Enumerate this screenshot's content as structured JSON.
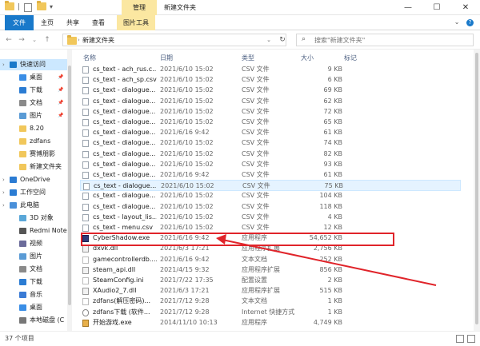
{
  "window": {
    "manage_tab": "管理",
    "title": "新建文件夹"
  },
  "ribbon": {
    "tabs": [
      "文件",
      "主页",
      "共享",
      "查看",
      "图片工具"
    ]
  },
  "address": {
    "path": "新建文件夹",
    "search_placeholder": "搜索\"新建文件夹\""
  },
  "sidebar": {
    "items": [
      {
        "label": "快速访问",
        "icon": "star-icon"
      },
      {
        "label": "桌面",
        "icon": "desktop-icon",
        "pinned": true
      },
      {
        "label": "下载",
        "icon": "download-icon",
        "pinned": true
      },
      {
        "label": "文档",
        "icon": "document-icon",
        "pinned": true
      },
      {
        "label": "图片",
        "icon": "picture-icon",
        "pinned": true
      },
      {
        "label": "8.20",
        "icon": "folder-icon"
      },
      {
        "label": "zdfans",
        "icon": "folder-icon"
      },
      {
        "label": "赛博朋影",
        "icon": "folder-icon"
      },
      {
        "label": "新建文件夹",
        "icon": "folder-icon"
      },
      {
        "label": "OneDrive",
        "icon": "cloud-icon"
      },
      {
        "label": "工作空间",
        "icon": "cloud-icon"
      },
      {
        "label": "此电脑",
        "icon": "computer-icon"
      },
      {
        "label": "3D 对象",
        "icon": "cube-icon"
      },
      {
        "label": "Redmi Note",
        "icon": "phone-icon"
      },
      {
        "label": "视频",
        "icon": "video-icon"
      },
      {
        "label": "图片",
        "icon": "picture-icon"
      },
      {
        "label": "文档",
        "icon": "document-icon"
      },
      {
        "label": "下载",
        "icon": "download-icon"
      },
      {
        "label": "音乐",
        "icon": "music-icon"
      },
      {
        "label": "桌面",
        "icon": "desktop-icon"
      },
      {
        "label": "本地磁盘 (C",
        "icon": "drive-icon"
      }
    ]
  },
  "columns": {
    "name": "名称",
    "date": "日期",
    "type": "类型",
    "size": "大小",
    "tags": "标记"
  },
  "files": [
    {
      "name": "cs_text - ach_rus.c...",
      "date": "2021/6/10 15:02",
      "type": "CSV 文件",
      "size": "9 KB",
      "icon": "csv-file-icon"
    },
    {
      "name": "cs_text - ach_sp.csv",
      "date": "2021/6/10 15:02",
      "type": "CSV 文件",
      "size": "6 KB",
      "icon": "csv-file-icon"
    },
    {
      "name": "cs_text - dialogue...",
      "date": "2021/6/10 15:02",
      "type": "CSV 文件",
      "size": "69 KB",
      "icon": "csv-file-icon"
    },
    {
      "name": "cs_text - dialogue...",
      "date": "2021/6/10 15:02",
      "type": "CSV 文件",
      "size": "62 KB",
      "icon": "csv-file-icon"
    },
    {
      "name": "cs_text - dialogue...",
      "date": "2021/6/10 15:02",
      "type": "CSV 文件",
      "size": "72 KB",
      "icon": "csv-file-icon"
    },
    {
      "name": "cs_text - dialogue...",
      "date": "2021/6/10 15:02",
      "type": "CSV 文件",
      "size": "65 KB",
      "icon": "csv-file-icon"
    },
    {
      "name": "cs_text - dialogue...",
      "date": "2021/6/16 9:42",
      "type": "CSV 文件",
      "size": "61 KB",
      "icon": "csv-file-icon"
    },
    {
      "name": "cs_text - dialogue...",
      "date": "2021/6/10 15:02",
      "type": "CSV 文件",
      "size": "74 KB",
      "icon": "csv-file-icon"
    },
    {
      "name": "cs_text - dialogue...",
      "date": "2021/6/10 15:02",
      "type": "CSV 文件",
      "size": "82 KB",
      "icon": "csv-file-icon"
    },
    {
      "name": "cs_text - dialogue...",
      "date": "2021/6/10 15:02",
      "type": "CSV 文件",
      "size": "93 KB",
      "icon": "csv-file-icon"
    },
    {
      "name": "cs_text - dialogue...",
      "date": "2021/6/16 9:42",
      "type": "CSV 文件",
      "size": "61 KB",
      "icon": "csv-file-icon"
    },
    {
      "name": "cs_text - dialogue...",
      "date": "2021/6/10 15:02",
      "type": "CSV 文件",
      "size": "75 KB",
      "icon": "csv-file-icon",
      "selected": true
    },
    {
      "name": "cs_text - dialogue...",
      "date": "2021/6/10 15:02",
      "type": "CSV 文件",
      "size": "104 KB",
      "icon": "csv-file-icon"
    },
    {
      "name": "cs_text - dialogue...",
      "date": "2021/6/10 15:02",
      "type": "CSV 文件",
      "size": "118 KB",
      "icon": "csv-file-icon"
    },
    {
      "name": "cs_text - layout_lis...",
      "date": "2021/6/10 15:02",
      "type": "CSV 文件",
      "size": "4 KB",
      "icon": "csv-file-icon"
    },
    {
      "name": "cs_text - menu.csv",
      "date": "2021/6/10 15:02",
      "type": "CSV 文件",
      "size": "12 KB",
      "icon": "csv-file-icon"
    },
    {
      "name": "CyberShadow.exe",
      "date": "2021/6/16 9:42",
      "type": "应用程序",
      "size": "54,652 KB",
      "icon": "game-exe-icon"
    },
    {
      "name": "dxvk.dll",
      "date": "2021/6/3 17:21",
      "type": "应用程序扩展",
      "size": "2,756 KB",
      "icon": "dll-file-icon"
    },
    {
      "name": "gamecontrollerdb....",
      "date": "2021/6/16 9:42",
      "type": "文本文档",
      "size": "252 KB",
      "icon": "text-file-icon"
    },
    {
      "name": "steam_api.dll",
      "date": "2021/4/15 9:32",
      "type": "应用程序扩展",
      "size": "856 KB",
      "icon": "dll-file-icon"
    },
    {
      "name": "SteamConfig.ini",
      "date": "2021/7/22 17:35",
      "type": "配置设置",
      "size": "2 KB",
      "icon": "ini-file-icon"
    },
    {
      "name": "XAudio2_7.dll",
      "date": "2021/6/3 17:21",
      "type": "应用程序扩展",
      "size": "515 KB",
      "icon": "dll-file-icon"
    },
    {
      "name": "zdfans(解压密码)...",
      "date": "2021/7/12 9:28",
      "type": "文本文档",
      "size": "1 KB",
      "icon": "text-file-icon"
    },
    {
      "name": "zdfans下载 (软件...",
      "date": "2021/7/12 9:28",
      "type": "Internet 快捷方式",
      "size": "1 KB",
      "icon": "url-shortcut-icon"
    },
    {
      "name": "开始游戏.exe",
      "date": "2014/11/10 10:13",
      "type": "应用程序",
      "size": "4,749 KB",
      "icon": "exe-file-icon"
    }
  ],
  "status": {
    "count": "37 个项目"
  },
  "annotation_color": "#e0242a"
}
